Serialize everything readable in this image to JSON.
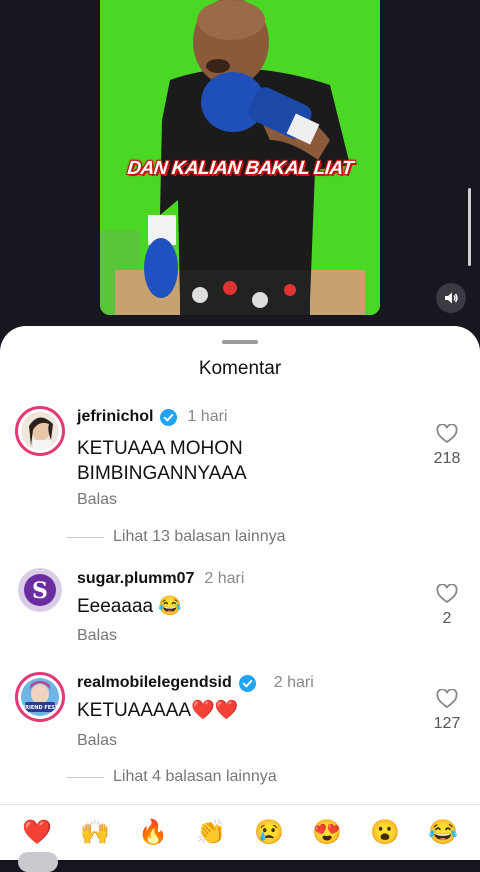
{
  "video": {
    "caption": "DAN KALIAN BAKAL LIAT",
    "sound_icon": "volume-icon"
  },
  "comments_sheet": {
    "title": "Komentar",
    "comments": [
      {
        "username": "jefrinichol",
        "verified": true,
        "time": "1 hari",
        "text": "KETUAAA MOHON BIMBINGANNYAAA",
        "reply_label": "Balas",
        "likes": "218",
        "more_replies": "Lihat 13 balasan lainnya"
      },
      {
        "username": "sugar.plumm07",
        "verified": false,
        "time": "2 hari",
        "text": "Eeeaaaa 😂",
        "reply_label": "Balas",
        "likes": "2"
      },
      {
        "username": "realmobilelegendsid",
        "verified": true,
        "time": "2 hari",
        "text": "KETUAAAAA❤️❤️",
        "reply_label": "Balas",
        "likes": "127",
        "avatar_text": "FRIEND FEST",
        "more_replies": "Lihat 4 balasan lainnya"
      }
    ]
  },
  "emoji_bar": [
    "❤️",
    "🙌",
    "🔥",
    "👏",
    "😢",
    "😍",
    "😮",
    "😂"
  ],
  "colors": {
    "verified": "#20a4f3",
    "sheet_bg": "#ffffff",
    "video_bg": "#4ad624"
  }
}
